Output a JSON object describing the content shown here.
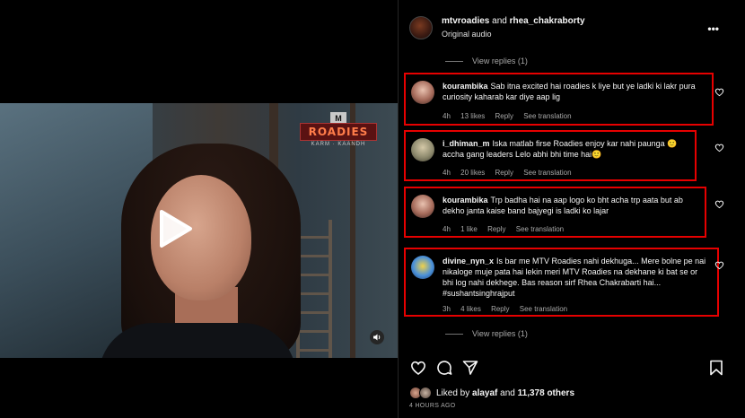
{
  "video": {
    "logo_mtv": "M",
    "logo_text": "ROADIES",
    "logo_sub": "KARM · KAANDH"
  },
  "post": {
    "user1": "mtvroadies",
    "and": "and",
    "user2": "rhea_chakraborty",
    "audio": "Original audio",
    "more": "•••"
  },
  "view_replies_top": "View replies (1)",
  "view_replies_bottom": "View replies (1)",
  "comments": [
    {
      "user": "kourambika",
      "text": "Sab itna excited hai roadies k liye but ye ladki ki lakr pura curiosity kaharab kar diye aap lig",
      "time": "4h",
      "likes": "13 likes",
      "reply": "Reply",
      "translate": "See translation"
    },
    {
      "user": "i_dhiman_m",
      "text": "Iska matlab firse Roadies enjoy kar nahi paunga 🙂 accha gang leaders Lelo abhi bhi time hai🙂",
      "time": "4h",
      "likes": "20 likes",
      "reply": "Reply",
      "translate": "See translation"
    },
    {
      "user": "kourambika",
      "text": "Trp badha hai na aap logo ko bht acha trp aata but ab dekho janta kaise band bajyegi is ladki ko lajar",
      "time": "4h",
      "likes": "1 like",
      "reply": "Reply",
      "translate": "See translation"
    },
    {
      "user": "divine_nyn_x",
      "text": "Is bar me MTV Roadies nahi dekhuga... Mere bolne pe nai nikaloge muje pata hai lekin meri MTV Roadies na dekhane ki bat se or bhi log nahi dekhege. Bas reason sirf Rhea Chakrabarti hai... #sushantsinghrajput",
      "time": "3h",
      "likes": "4 likes",
      "reply": "Reply",
      "translate": "See translation"
    }
  ],
  "likes": {
    "prefix": "Liked by",
    "user": "alayaf",
    "and": "and",
    "count": "11,378 others"
  },
  "timestamp": "4 HOURS AGO",
  "colors": {
    "highlight": "#e60000",
    "secondary_text": "#a8a8a8"
  }
}
